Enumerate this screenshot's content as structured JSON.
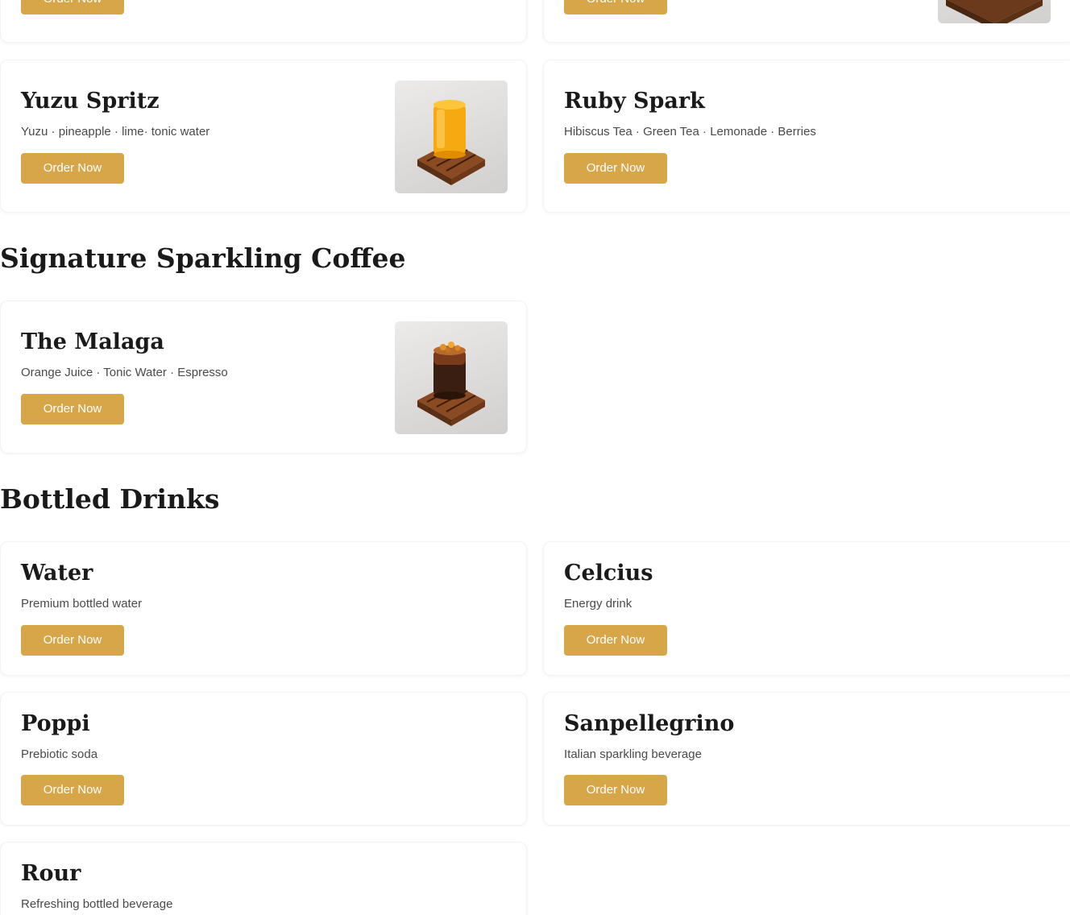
{
  "order_label": "Order Now",
  "sections": {
    "sparkling_coffee": {
      "heading": "Signature Sparkling Coffee"
    },
    "bottled": {
      "heading": "Bottled Drinks"
    }
  },
  "items": {
    "yuzu_spritz": {
      "name": "Yuzu Spritz",
      "description": "Yuzu · pineapple · lime· tonic water",
      "image": "yuzu-spritz-drink-image"
    },
    "ruby_spark": {
      "name": "Ruby Spark",
      "description": "Hibiscus Tea · Green Tea · Lemonade · Berries"
    },
    "the_malaga": {
      "name": "The Malaga",
      "description": "Orange Juice · Tonic Water · Espresso",
      "image": "the-malaga-drink-image"
    },
    "water": {
      "name": "Water",
      "description": "Premium bottled water"
    },
    "celcius": {
      "name": "Celcius",
      "description": "Energy drink"
    },
    "poppi": {
      "name": "Poppi",
      "description": "Prebiotic soda"
    },
    "sanpellegrino": {
      "name": "Sanpellegrino",
      "description": "Italian sparkling beverage"
    },
    "rour": {
      "name": "Rour",
      "description": "Refreshing bottled beverage"
    }
  },
  "colors": {
    "accent": "#d6a649",
    "heading": "#1a1a1a",
    "description": "#4a4a4a",
    "background": "#ffffff"
  }
}
